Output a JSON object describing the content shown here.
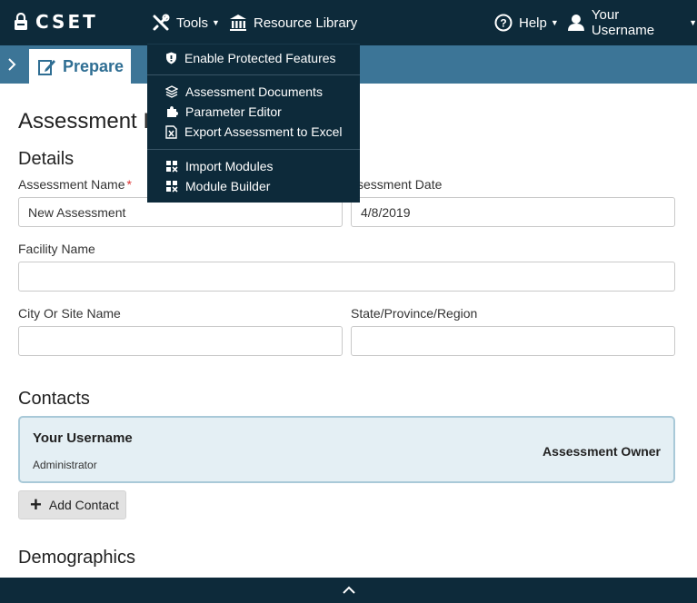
{
  "app": {
    "logo_text": "CSET"
  },
  "navbar": {
    "tools_label": "Tools",
    "resource_library_label": "Resource Library",
    "help_label": "Help",
    "username_label": "Your Username"
  },
  "subnav": {
    "prepare_label": "Prepare"
  },
  "tools_menu": {
    "items": [
      {
        "label": "Enable Protected Features",
        "icon": "shield-icon"
      },
      {
        "label": "Assessment Documents",
        "icon": "layers-icon"
      },
      {
        "label": "Parameter Editor",
        "icon": "puzzle-icon"
      },
      {
        "label": "Export Assessment to Excel",
        "icon": "excel-icon"
      },
      {
        "label": "Import Modules",
        "icon": "modules-icon"
      },
      {
        "label": "Module Builder",
        "icon": "modules-icon"
      }
    ]
  },
  "page": {
    "title": "Assessment I",
    "details_heading": "Details",
    "assessment_name_label": "Assessment Name",
    "assessment_name_value": "New Assessment",
    "assessment_date_label": "ssessment Date",
    "assessment_date_value": "4/8/2019",
    "facility_name_label": "Facility Name",
    "facility_name_value": "",
    "city_label": "City Or Site Name",
    "city_value": "",
    "state_label": "State/Province/Region",
    "state_value": "",
    "contacts_heading": "Contacts",
    "demographics_heading": "Demographics"
  },
  "contact": {
    "name": "Your Username",
    "role": "Administrator",
    "owner_label": "Assessment Owner"
  },
  "add_contact_label": "Add Contact",
  "colors": {
    "navbar": "#0d2a3a",
    "subnav": "#3c7597",
    "contact_card": "#e4eff4"
  }
}
